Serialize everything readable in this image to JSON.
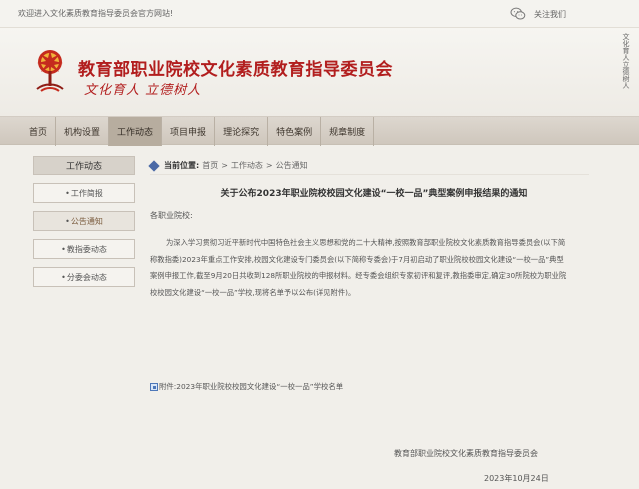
{
  "topbar": {
    "welcome": "欢迎进入文化素质教育指导委员会官方网站!",
    "follow": "关注我们",
    "follow_icon": "wechat-icon"
  },
  "header": {
    "title": "教育部职业院校文化素质教育指导委员会",
    "slogan": "文化育人 立德树人",
    "calligraphy": "文化育人立德树人",
    "accent_color": "#b21e1e"
  },
  "nav": {
    "items": [
      "首页",
      "机构设置",
      "工作动态",
      "项目申报",
      "理论探究",
      "特色案例",
      "规章制度"
    ],
    "active_index": 2
  },
  "sidebar": {
    "heading": "工作动态",
    "items": [
      "工作简报",
      "公告通知",
      "教指委动态",
      "分委会动态"
    ],
    "active_index": 1
  },
  "breadcrumb": {
    "label": "当前位置:",
    "home": "首页",
    "section": "工作动态",
    "current": "公告通知",
    "separator": ">"
  },
  "article": {
    "title": "关于公布2023年职业院校校园文化建设“一校一品”典型案例申报结果的通知",
    "greeting": "各职业院校:",
    "body": "为深入学习贯彻习近平新时代中国特色社会主义思想和党的二十大精神,按照教育部职业院校文化素质教育指导委员会(以下简称教指委)2023年重点工作安排,校园文化建设专门委员会(以下简称专委会)于7月初启动了职业院校校园文化建设“一校一品”典型案例申报工作,截至9月20日共收到128所职业院校的申报材料。经专委会组织专家初评和复评,教指委审定,确定30所院校为职业院校校园文化建设“一校一品”学校,现将名单予以公布(详见附件)。",
    "attachment": "附件:2023年职业院校校园文化建设“一校一品”学校名单",
    "signature": "教育部职业院校文化素质教育指导委员会",
    "date": "2023年10月24日"
  }
}
